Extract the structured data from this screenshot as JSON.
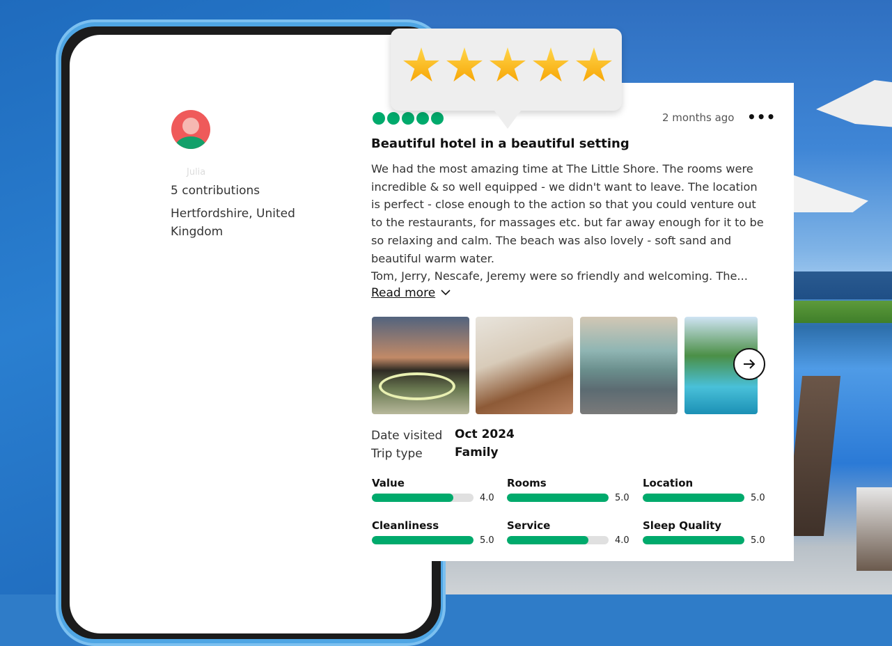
{
  "reviewer": {
    "name": "Julia",
    "contributions": "5 contributions",
    "location": "Hertfordshire, United Kingdom"
  },
  "star_popup": {
    "stars": 5
  },
  "review": {
    "rating_bubbles": 5,
    "time_ago": "2 months ago",
    "more_icon": "more-horizontal-icon",
    "title": "Beautiful hotel in a beautiful setting",
    "body": "We had the most amazing time at The Little Shore. The rooms were incredible & so well equipped - we didn't want to leave. The location is perfect - close enough to the action so that you could venture out to the restaurants, for massages etc. but far away enough for it to be so relaxing and calm. The beach was also lovely - soft sand and beautiful warm water.\nTom, Jerry, Nescafe, Jeremy were so friendly and welcoming. The...",
    "read_more": "Read more",
    "chevron_icon": "chevron-down-icon",
    "next_icon": "arrow-right-icon",
    "photos": [
      "pool-at-sunset-photo",
      "wooden-figures-photo",
      "villa-terrace-photo",
      "private-pool-photo"
    ]
  },
  "facts": {
    "date_visited_label": "Date visited",
    "date_visited_value": "Oct 2024",
    "trip_type_label": "Trip type",
    "trip_type_value": "Family"
  },
  "ratings": [
    {
      "label": "Value",
      "score": "4.0",
      "value": 4.0
    },
    {
      "label": "Rooms",
      "score": "5.0",
      "value": 5.0
    },
    {
      "label": "Location",
      "score": "5.0",
      "value": 5.0
    },
    {
      "label": "Cleanliness",
      "score": "5.0",
      "value": 5.0
    },
    {
      "label": "Service",
      "score": "4.0",
      "value": 4.0
    },
    {
      "label": "Sleep Quality",
      "score": "5.0",
      "value": 5.0
    }
  ],
  "colors": {
    "accent_green": "#00aa6c",
    "star_gold": "#f6a200",
    "background_blue": "#2f7cc8",
    "avatar_red": "#ef5a5a"
  }
}
